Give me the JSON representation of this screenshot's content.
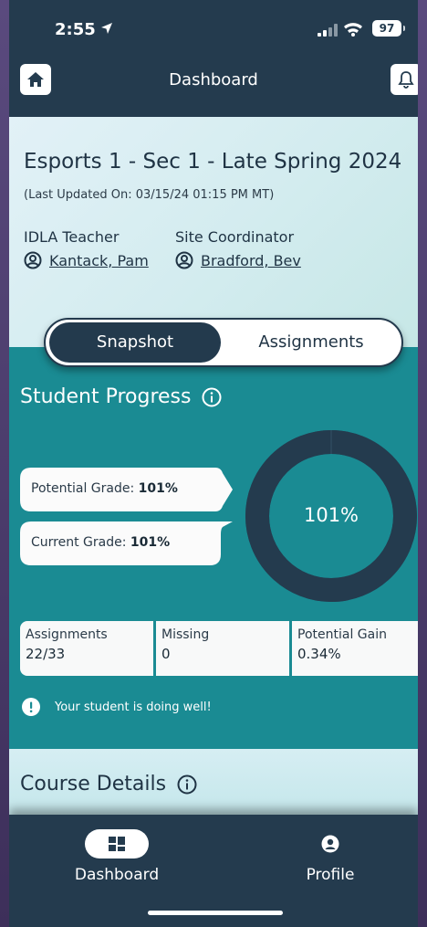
{
  "status": {
    "time": "2:55",
    "battery": "97"
  },
  "nav": {
    "title": "Dashboard"
  },
  "course": {
    "title": "Esports 1 - Sec 1 - Late Spring 2024",
    "last_updated": "(Last Updated On: 03/15/24 01:15 PM  MT)",
    "teacher_label": "IDLA Teacher",
    "teacher_name": "Kantack, Pam",
    "coordinator_label": "Site Coordinator",
    "coordinator_name": "Bradford, Bev"
  },
  "tabs": {
    "snapshot": "Snapshot",
    "assignments": "Assignments",
    "active": "Snapshot"
  },
  "progress": {
    "title": "Student Progress",
    "potential_label": "Potential Grade: ",
    "potential_value": "101%",
    "current_label": "Current Grade: ",
    "current_value": "101%",
    "donut_label": "101%",
    "donut_fraction": 1.0
  },
  "stats": {
    "assignments_label": "Assignments",
    "assignments_value": "22/33",
    "missing_label": "Missing",
    "missing_value": "0",
    "gain_label": "Potential Gain",
    "gain_value": "0.34%"
  },
  "notice": {
    "text": "Your student is doing well!"
  },
  "details": {
    "title": "Course Details"
  },
  "bottom_nav": {
    "dashboard": "Dashboard",
    "profile": "Profile",
    "active": "Dashboard"
  },
  "colors": {
    "navy": "#243b4e",
    "teal": "#1a8b93",
    "header_bg": "#d3ecef",
    "white": "#ffffff"
  },
  "icons": {
    "home": "home-icon",
    "bell": "bell-icon",
    "person": "person-circle-icon",
    "info": "info-icon",
    "alert": "exclamation-icon",
    "dashboard": "dashboard-grid-icon",
    "profile": "profile-icon"
  }
}
